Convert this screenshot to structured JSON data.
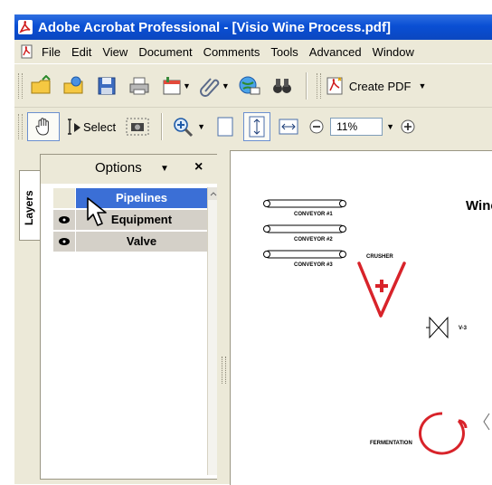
{
  "window": {
    "title": "Adobe Acrobat Professional - [Visio Wine Process.pdf]"
  },
  "menu": {
    "items": [
      "File",
      "Edit",
      "View",
      "Document",
      "Comments",
      "Tools",
      "Advanced",
      "Window"
    ]
  },
  "toolbar": {
    "create_pdf_label": "Create PDF",
    "select_label": "Select",
    "zoom_value": "11%"
  },
  "layers_panel": {
    "tab_label": "Layers",
    "options_label": "Options",
    "close_glyph": "×",
    "layers": [
      {
        "name": "Pipelines",
        "visible": false,
        "selected": true
      },
      {
        "name": "Equipment",
        "visible": true,
        "selected": false
      },
      {
        "name": "Valve",
        "visible": true,
        "selected": false
      }
    ]
  },
  "document": {
    "title_partial": "Wine",
    "labels": {
      "conveyor1": "CONVEYOR #1",
      "conveyor2": "CONVEYOR #2",
      "conveyor3": "CONVEYOR #3",
      "crusher": "CRUSHER",
      "valve": "V-3",
      "fermentation": "FERMENTATION"
    }
  },
  "colors": {
    "title_bar": "#0a4fd4",
    "selected_layer": "#3b6fd6",
    "crusher": "#d8232a"
  }
}
